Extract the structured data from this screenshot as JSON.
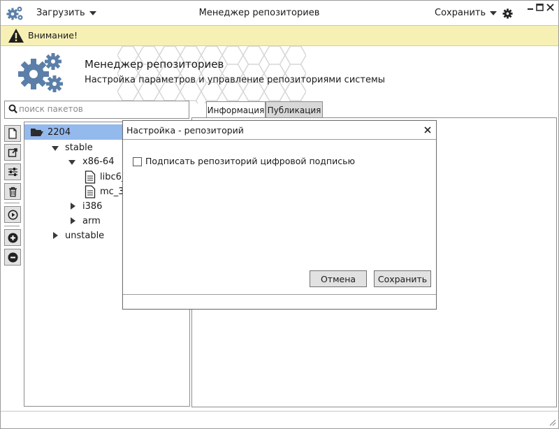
{
  "window": {
    "title": "Менеджер репозиториев",
    "menu_load": "Загрузить",
    "menu_save": "Сохранить"
  },
  "warning": {
    "text": "Внимание!"
  },
  "header": {
    "title": "Менеджер репозиториев",
    "subtitle": "Настройка параметров и управление репозиториями системы"
  },
  "search": {
    "placeholder": "поиск пакетов"
  },
  "tabs": [
    {
      "label": "Информация",
      "active": true
    },
    {
      "label": "Публикация",
      "active": false
    }
  ],
  "tree": {
    "root": "2204",
    "stable": "stable",
    "x86": "x86-64",
    "file1": "libc6_",
    "file2": "mc_3",
    "i386": "i386",
    "arm": "arm",
    "unstable": "unstable"
  },
  "dialog": {
    "title": "Настройка - репозиторий",
    "checkbox_label": "Подписать репозиторий цифровой подписью",
    "checked": false,
    "cancel_label": "Отмена",
    "save_label": "Сохранить"
  },
  "icons": {
    "app": "gears-icon",
    "warning": "warning-icon",
    "search": "search-icon",
    "toolbar": [
      "new-file-icon",
      "open-external-icon",
      "sliders-icon",
      "trash-icon",
      "play-icon",
      "add-icon",
      "remove-icon"
    ]
  },
  "colors": {
    "accent": "#5b7fa8",
    "selection": "#94b9ed",
    "warning_bg": "#f7f0b5"
  }
}
